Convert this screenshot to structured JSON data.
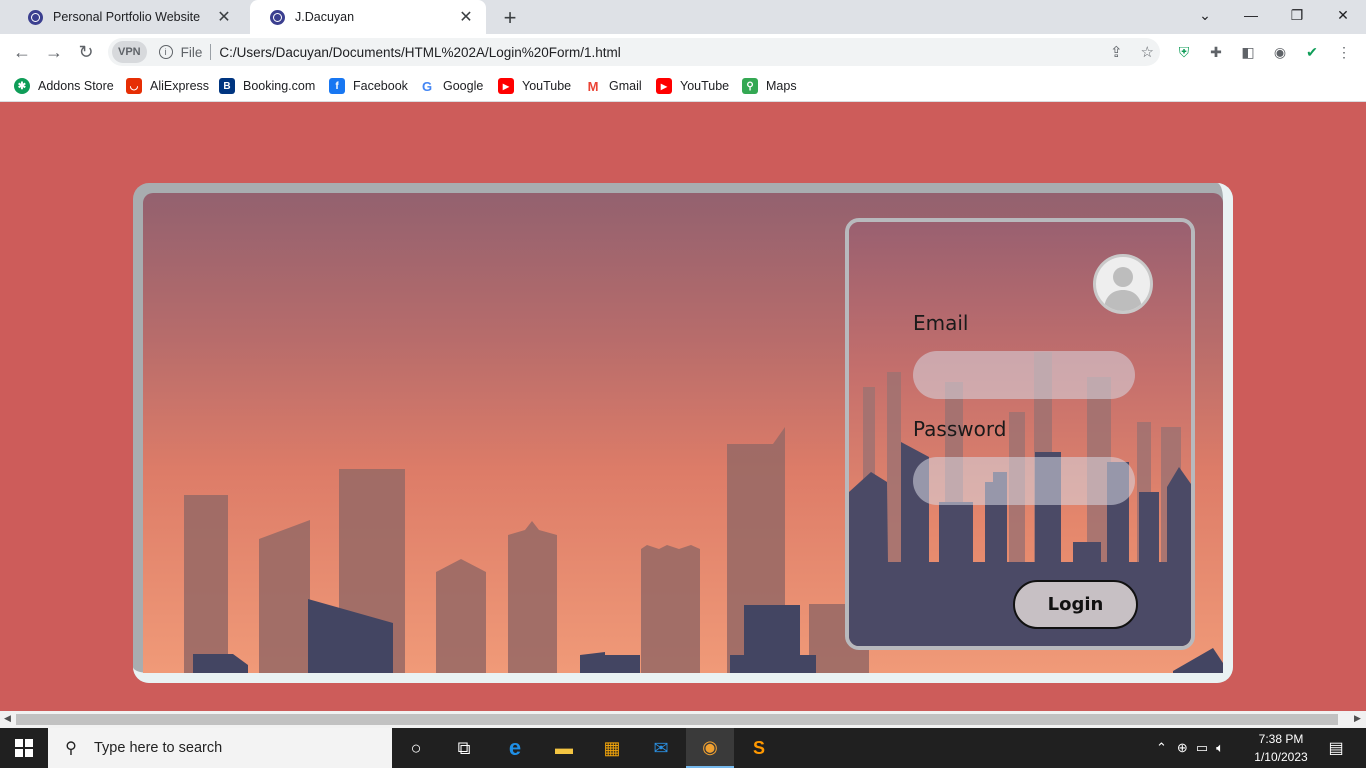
{
  "browser": {
    "tabs": [
      {
        "title": "Personal Portfolio Website",
        "active": false
      },
      {
        "title": "J.Dacuyan",
        "active": true
      }
    ],
    "new_tab": "+",
    "address": {
      "vpn_badge": "VPN",
      "scheme_label": "File",
      "url": "C:/Users/Dacuyan/Documents/HTML%202A/Login%20Form/1.html"
    },
    "bookmarks": [
      {
        "label": "Addons Store",
        "icon": "addons-store-icon",
        "color": "#0f9d58"
      },
      {
        "label": "AliExpress",
        "icon": "aliexpress-icon",
        "color": "#e62e04"
      },
      {
        "label": "Booking.com",
        "icon": "booking-icon",
        "color": "#003580"
      },
      {
        "label": "Facebook",
        "icon": "facebook-icon",
        "color": "#1877f2"
      },
      {
        "label": "Google",
        "icon": "google-icon",
        "color": "#4285f4"
      },
      {
        "label": "YouTube",
        "icon": "youtube-icon",
        "color": "#ff0000"
      },
      {
        "label": "Gmail",
        "icon": "gmail-icon",
        "color": "#ea4335"
      },
      {
        "label": "YouTube",
        "icon": "youtube-icon",
        "color": "#ff0000"
      },
      {
        "label": "Maps",
        "icon": "maps-icon",
        "color": "#34a853"
      }
    ]
  },
  "page": {
    "background_color": "#cd5c5a",
    "login": {
      "email_label": "Email",
      "email_value": "",
      "password_label": "Password",
      "password_value": "",
      "login_button": "Login"
    }
  },
  "taskbar": {
    "search_placeholder": "Type here to search",
    "time": "7:38 PM",
    "date": "1/10/2023"
  }
}
